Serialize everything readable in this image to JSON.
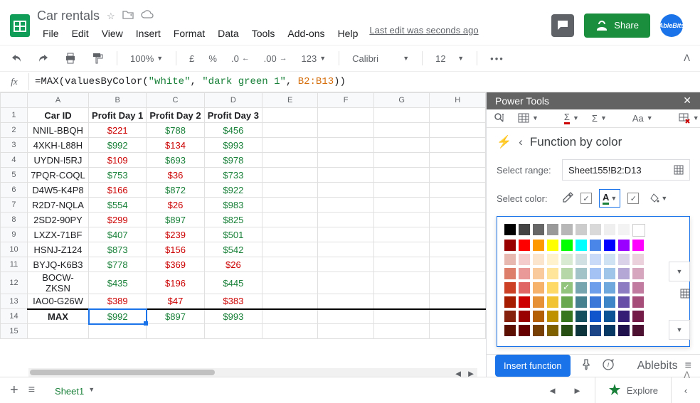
{
  "doc": {
    "title": "Car rentals",
    "lastEdit": "Last edit was seconds ago"
  },
  "menus": [
    "File",
    "Edit",
    "View",
    "Insert",
    "Format",
    "Data",
    "Tools",
    "Add-ons",
    "Help"
  ],
  "share": "Share",
  "avatar": "AbleBits",
  "toolbar": {
    "zoom": "100%",
    "currency": "£",
    "pct": "%",
    "dec1": ".0",
    "dec2": ".00",
    "numfmt": "123",
    "font": "Calibri",
    "size": "12"
  },
  "formula": {
    "fn": "MAX",
    "inner": "valuesByColor",
    "s1": "\"white\"",
    "s2": "\"dark green 1\"",
    "ref": "B2:B13"
  },
  "columns": [
    "",
    "A",
    "B",
    "C",
    "D",
    "E",
    "F",
    "G",
    "H"
  ],
  "rows": [
    {
      "n": 1,
      "cells": [
        {
          "v": "Car ID",
          "b": true
        },
        {
          "v": "Profit Day 1",
          "b": true
        },
        {
          "v": "Profit Day 2",
          "b": true
        },
        {
          "v": "Profit Day 3",
          "b": true
        },
        {
          "v": ""
        },
        {
          "v": ""
        },
        {
          "v": ""
        },
        {
          "v": ""
        }
      ]
    },
    {
      "n": 2,
      "cells": [
        {
          "v": "NNIL-BBQH"
        },
        {
          "v": "$221",
          "c": "red"
        },
        {
          "v": "$788",
          "c": "green"
        },
        {
          "v": "$456",
          "c": "green"
        },
        {
          "v": ""
        },
        {
          "v": ""
        },
        {
          "v": ""
        },
        {
          "v": ""
        }
      ]
    },
    {
      "n": 3,
      "cells": [
        {
          "v": "4XKH-L88H"
        },
        {
          "v": "$992",
          "c": "green"
        },
        {
          "v": "$134",
          "c": "red"
        },
        {
          "v": "$993",
          "c": "green"
        },
        {
          "v": ""
        },
        {
          "v": ""
        },
        {
          "v": ""
        },
        {
          "v": ""
        }
      ]
    },
    {
      "n": 4,
      "cells": [
        {
          "v": "UYDN-I5RJ"
        },
        {
          "v": "$109",
          "c": "red"
        },
        {
          "v": "$693",
          "c": "green"
        },
        {
          "v": "$978",
          "c": "green"
        },
        {
          "v": ""
        },
        {
          "v": ""
        },
        {
          "v": ""
        },
        {
          "v": ""
        }
      ]
    },
    {
      "n": 5,
      "cells": [
        {
          "v": "7PQR-COQL"
        },
        {
          "v": "$753",
          "c": "green"
        },
        {
          "v": "$36",
          "c": "red"
        },
        {
          "v": "$733",
          "c": "green"
        },
        {
          "v": ""
        },
        {
          "v": ""
        },
        {
          "v": ""
        },
        {
          "v": ""
        }
      ]
    },
    {
      "n": 6,
      "cells": [
        {
          "v": "D4W5-K4P8"
        },
        {
          "v": "$166",
          "c": "red"
        },
        {
          "v": "$872",
          "c": "green"
        },
        {
          "v": "$922",
          "c": "green"
        },
        {
          "v": ""
        },
        {
          "v": ""
        },
        {
          "v": ""
        },
        {
          "v": ""
        }
      ]
    },
    {
      "n": 7,
      "cells": [
        {
          "v": "R2D7-NQLA"
        },
        {
          "v": "$554",
          "c": "green"
        },
        {
          "v": "$26",
          "c": "red"
        },
        {
          "v": "$983",
          "c": "green"
        },
        {
          "v": ""
        },
        {
          "v": ""
        },
        {
          "v": ""
        },
        {
          "v": ""
        }
      ]
    },
    {
      "n": 8,
      "cells": [
        {
          "v": "2SD2-90PY"
        },
        {
          "v": "$299",
          "c": "red"
        },
        {
          "v": "$897",
          "c": "green"
        },
        {
          "v": "$825",
          "c": "green"
        },
        {
          "v": ""
        },
        {
          "v": ""
        },
        {
          "v": ""
        },
        {
          "v": ""
        }
      ]
    },
    {
      "n": 9,
      "cells": [
        {
          "v": "LXZX-71BF"
        },
        {
          "v": "$407",
          "c": "green"
        },
        {
          "v": "$239",
          "c": "red"
        },
        {
          "v": "$501",
          "c": "green"
        },
        {
          "v": ""
        },
        {
          "v": ""
        },
        {
          "v": ""
        },
        {
          "v": ""
        }
      ]
    },
    {
      "n": 10,
      "cells": [
        {
          "v": "HSNJ-Z124"
        },
        {
          "v": "$873",
          "c": "green"
        },
        {
          "v": "$156",
          "c": "red"
        },
        {
          "v": "$542",
          "c": "green"
        },
        {
          "v": ""
        },
        {
          "v": ""
        },
        {
          "v": ""
        },
        {
          "v": ""
        }
      ]
    },
    {
      "n": 11,
      "cells": [
        {
          "v": "BYJQ-K6B3"
        },
        {
          "v": "$778",
          "c": "green"
        },
        {
          "v": "$369",
          "c": "red"
        },
        {
          "v": "$26",
          "c": "red"
        },
        {
          "v": ""
        },
        {
          "v": ""
        },
        {
          "v": ""
        },
        {
          "v": ""
        }
      ]
    },
    {
      "n": 12,
      "cells": [
        {
          "v": "BOCW-ZKSN"
        },
        {
          "v": "$435",
          "c": "green"
        },
        {
          "v": "$196",
          "c": "red"
        },
        {
          "v": "$445",
          "c": "green"
        },
        {
          "v": ""
        },
        {
          "v": ""
        },
        {
          "v": ""
        },
        {
          "v": ""
        }
      ]
    },
    {
      "n": 13,
      "cells": [
        {
          "v": "IAO0-G26W"
        },
        {
          "v": "$389",
          "c": "red"
        },
        {
          "v": "$47",
          "c": "red"
        },
        {
          "v": "$383",
          "c": "red"
        },
        {
          "v": ""
        },
        {
          "v": ""
        },
        {
          "v": ""
        },
        {
          "v": ""
        }
      ],
      "bb": true
    },
    {
      "n": 14,
      "cells": [
        {
          "v": "MAX",
          "b": true
        },
        {
          "v": "$992",
          "c": "green",
          "sel": true
        },
        {
          "v": "$897",
          "c": "green"
        },
        {
          "v": "$993",
          "c": "green"
        },
        {
          "v": ""
        },
        {
          "v": ""
        },
        {
          "v": ""
        },
        {
          "v": ""
        }
      ]
    },
    {
      "n": 15,
      "cells": [
        {
          "v": ""
        },
        {
          "v": ""
        },
        {
          "v": ""
        },
        {
          "v": ""
        },
        {
          "v": ""
        },
        {
          "v": ""
        },
        {
          "v": ""
        },
        {
          "v": ""
        }
      ]
    }
  ],
  "panel": {
    "title": "Power Tools",
    "section": "Function by color",
    "rangeLabel": "Select range:",
    "rangeValue": "Sheet155!B2:D13",
    "colorLabel": "Select color:",
    "insert": "Insert function",
    "brand": "Ablebits"
  },
  "palette": [
    [
      "#000000",
      "#434343",
      "#666666",
      "#999999",
      "#b7b7b7",
      "#cccccc",
      "#d9d9d9",
      "#efefef",
      "#f3f3f3",
      "#ffffff"
    ],
    [
      "#980000",
      "#ff0000",
      "#ff9900",
      "#ffff00",
      "#00ff00",
      "#00ffff",
      "#4a86e8",
      "#0000ff",
      "#9900ff",
      "#ff00ff"
    ],
    [
      "#e6b8af",
      "#f4cccc",
      "#fce5cd",
      "#fff2cc",
      "#d9ead3",
      "#d0e0e3",
      "#c9daf8",
      "#cfe2f3",
      "#d9d2e9",
      "#ead1dc"
    ],
    [
      "#dd7e6b",
      "#ea9999",
      "#f9cb9c",
      "#ffe599",
      "#b6d7a8",
      "#a2c4c9",
      "#a4c2f4",
      "#9fc5e8",
      "#b4a7d6",
      "#d5a6bd"
    ],
    [
      "#cc4125",
      "#e06666",
      "#f6b26b",
      "#ffd966",
      "#93c47d",
      "#76a5af",
      "#6d9eeb",
      "#6fa8dc",
      "#8e7cc3",
      "#c27ba0"
    ],
    [
      "#a61c00",
      "#cc0000",
      "#e69138",
      "#f1c232",
      "#6aa84f",
      "#45818e",
      "#3c78d8",
      "#3d85c6",
      "#674ea7",
      "#a64d79"
    ],
    [
      "#85200c",
      "#990000",
      "#b45f06",
      "#bf9000",
      "#38761d",
      "#134f5c",
      "#1155cc",
      "#0b5394",
      "#351c75",
      "#741b47"
    ],
    [
      "#5b0f00",
      "#660000",
      "#783f04",
      "#7f6000",
      "#274e13",
      "#0c343d",
      "#1c4587",
      "#073763",
      "#20124d",
      "#4c1130"
    ]
  ],
  "paletteSelected": "#93c47d",
  "sheet": {
    "tab": "Sheet1",
    "explore": "Explore"
  }
}
